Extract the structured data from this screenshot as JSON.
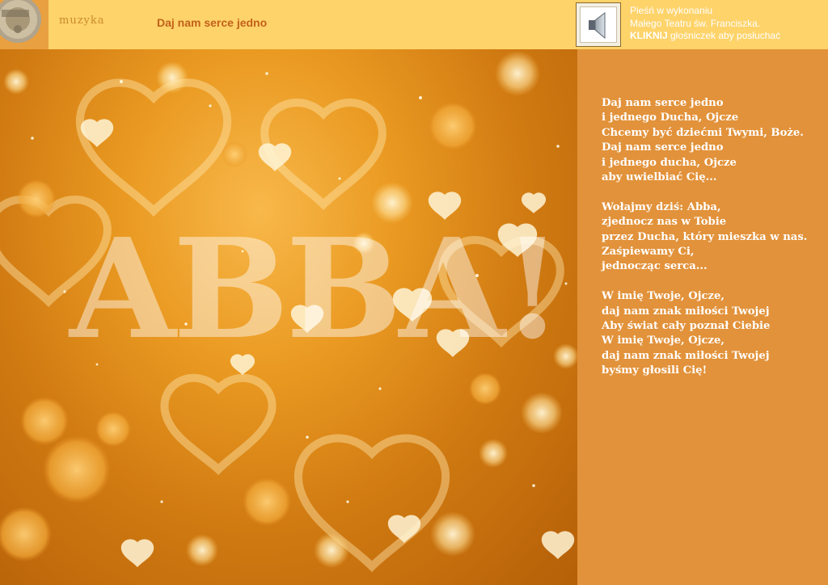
{
  "header": {
    "section_label": "muzyka",
    "song_title": "Daj nam serce jedno",
    "info_line1": "Pieśń w wykonaniu",
    "info_line2": "Małego Teatru św. Franciszka.",
    "info_click": "KLIKNIJ",
    "info_rest": " głośniczek aby posłuchać",
    "speaker_icon": "speaker-icon"
  },
  "image": {
    "overlay_word": "ABBA!"
  },
  "lyrics": {
    "stanzas": [
      [
        "Daj nam serce jedno",
        "i jednego Ducha, Ojcze",
        "Chcemy być dziećmi Twymi, Boże.",
        "Daj nam serce jedno",
        "i jednego ducha, Ojcze",
        "aby uwielbiać Cię..."
      ],
      [
        "Wołajmy dziś: Abba,",
        "zjednocz nas w Tobie",
        "przez Ducha, który mieszka w nas.",
        "Zaśpiewamy Ci,",
        "jednocząc serca..."
      ],
      [
        "W imię Twoje, Ojcze,",
        "daj nam znak miłości Twojej",
        "Aby świat cały poznał Ciebie",
        "W imię Twoje, Ojcze,",
        "daj nam znak miłości Twojej",
        "byśmy głosili Cię!"
      ]
    ]
  },
  "colors": {
    "header_bg": "#fed36a",
    "panel_bg": "#e2923a",
    "title_color": "#c2611a"
  }
}
